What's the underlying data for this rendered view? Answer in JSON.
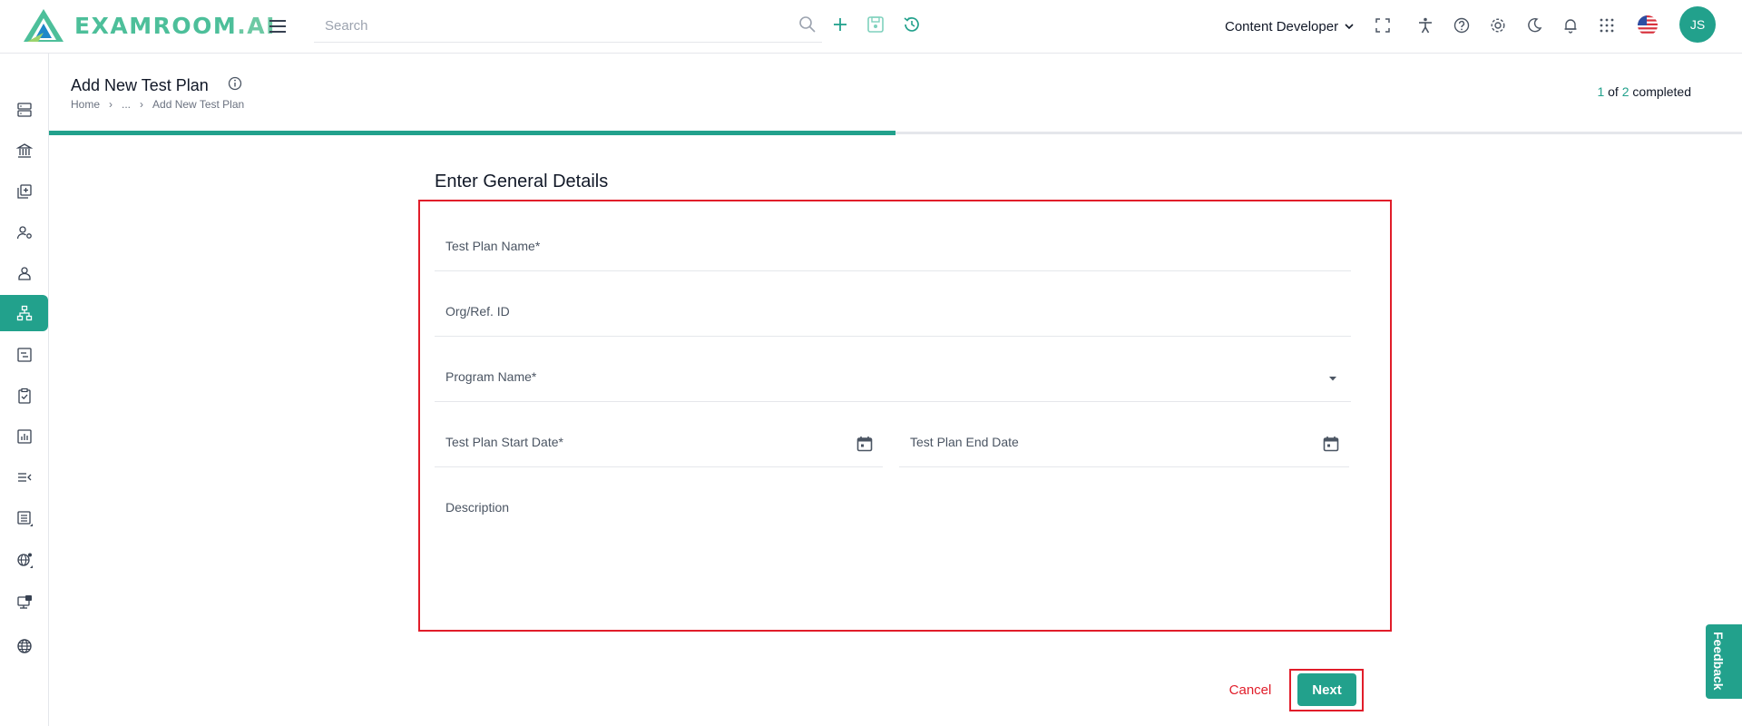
{
  "app": {
    "brand": "EXAMROOM",
    "brand_suffix": ".AI",
    "colors": {
      "accent": "#22a18c",
      "highlight": "#e11d2a",
      "border": "#e5e7eb"
    }
  },
  "topbar": {
    "search_placeholder": "Search",
    "role": "Content Developer",
    "avatar_initials": "JS",
    "actions": [
      "plus-icon",
      "save-icon",
      "history-icon"
    ],
    "right_icons": [
      "fullscreen-icon",
      "accessibility-icon",
      "help-icon",
      "settings-icon",
      "dark-mode-icon",
      "notification-icon",
      "apps-grid-icon",
      "us-flag-icon"
    ]
  },
  "sidebar": {
    "items": [
      {
        "icon": "server-icon"
      },
      {
        "icon": "bank-icon"
      },
      {
        "icon": "add-library-icon"
      },
      {
        "icon": "user-settings-icon"
      },
      {
        "icon": "user-icon"
      },
      {
        "icon": "hierarchy-icon",
        "active": true
      },
      {
        "icon": "report-icon"
      },
      {
        "icon": "clipboard-check-icon"
      },
      {
        "icon": "chart-icon"
      },
      {
        "icon": "list-collapse-icon"
      },
      {
        "icon": "list-expand-icon"
      },
      {
        "icon": "globe-settings-icon"
      },
      {
        "icon": "monitor-icon"
      },
      {
        "icon": "globe-icon"
      }
    ]
  },
  "header": {
    "title": "Add New Test Plan",
    "breadcrumb": {
      "home": "Home",
      "ellipsis": "...",
      "current": "Add New Test Plan",
      "separator": "›"
    },
    "progress": {
      "done": "1",
      "of": "of",
      "total": "2",
      "completed": "completed",
      "fraction": 0.5
    }
  },
  "form": {
    "section_title": "Enter General Details",
    "fields": {
      "test_plan_name": {
        "label": "Test Plan Name*",
        "value": ""
      },
      "org_ref_id": {
        "label": "Org/Ref. ID",
        "value": ""
      },
      "program_name": {
        "label": "Program Name*",
        "value": ""
      },
      "start_date": {
        "label": "Test Plan Start Date*",
        "value": ""
      },
      "end_date": {
        "label": "Test Plan End Date",
        "value": ""
      },
      "description": {
        "label": "Description",
        "value": ""
      }
    },
    "cancel_label": "Cancel",
    "next_label": "Next"
  },
  "feedback": {
    "label": "Feedback"
  }
}
